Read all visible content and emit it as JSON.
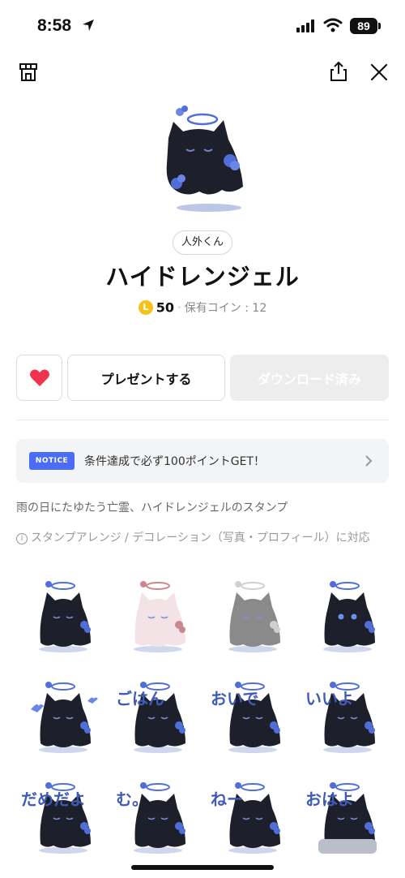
{
  "status_bar": {
    "time": "8:58",
    "battery": "89"
  },
  "product": {
    "author": "人外くん",
    "title": "ハイドレンジェル",
    "coin_symbol": "L",
    "price": "50",
    "owned_coins": "保有コイン : 12"
  },
  "actions": {
    "present_label": "プレゼントする",
    "download_label": "ダウンロード済み"
  },
  "notice": {
    "badge": "NOTICE",
    "text": "条件達成で必ず100ポイントGET！"
  },
  "description": "雨の日にたゆたう亡霊、ハイドレンジェルのスタンプ",
  "compat_note": "スタンプアレンジ / デコレーション（写真・プロフィール）に対応",
  "stickers": [
    {
      "caption": "",
      "theme": "dark-sleeping"
    },
    {
      "caption": "",
      "theme": "pink-sleeping"
    },
    {
      "caption": "",
      "theme": "gray-sleeping"
    },
    {
      "caption": "",
      "theme": "dark-blue-eyes"
    },
    {
      "caption": "",
      "theme": "dark-hearts"
    },
    {
      "caption": "ごはん",
      "theme": "dark"
    },
    {
      "caption": "おいで",
      "theme": "dark"
    },
    {
      "caption": "いいよ",
      "theme": "dark"
    },
    {
      "caption": "だめだよ",
      "theme": "dark"
    },
    {
      "caption": "む。",
      "theme": "dark"
    },
    {
      "caption": "ねー",
      "theme": "dark"
    },
    {
      "caption": "おはよ",
      "theme": "dark-bed"
    }
  ],
  "colors": {
    "accent_blue": "#4a6cf7",
    "heart_red": "#f0344f",
    "coin_yellow": "#f5c21b",
    "ghost_dark": "#1d1f2b",
    "hydrangea_blue": "#4f6ed8"
  },
  "icons": [
    "location-arrow-icon",
    "signal-icon",
    "wifi-icon",
    "shop-icon",
    "share-icon",
    "close-icon",
    "heart-icon",
    "chevron-right-icon",
    "info-icon"
  ]
}
